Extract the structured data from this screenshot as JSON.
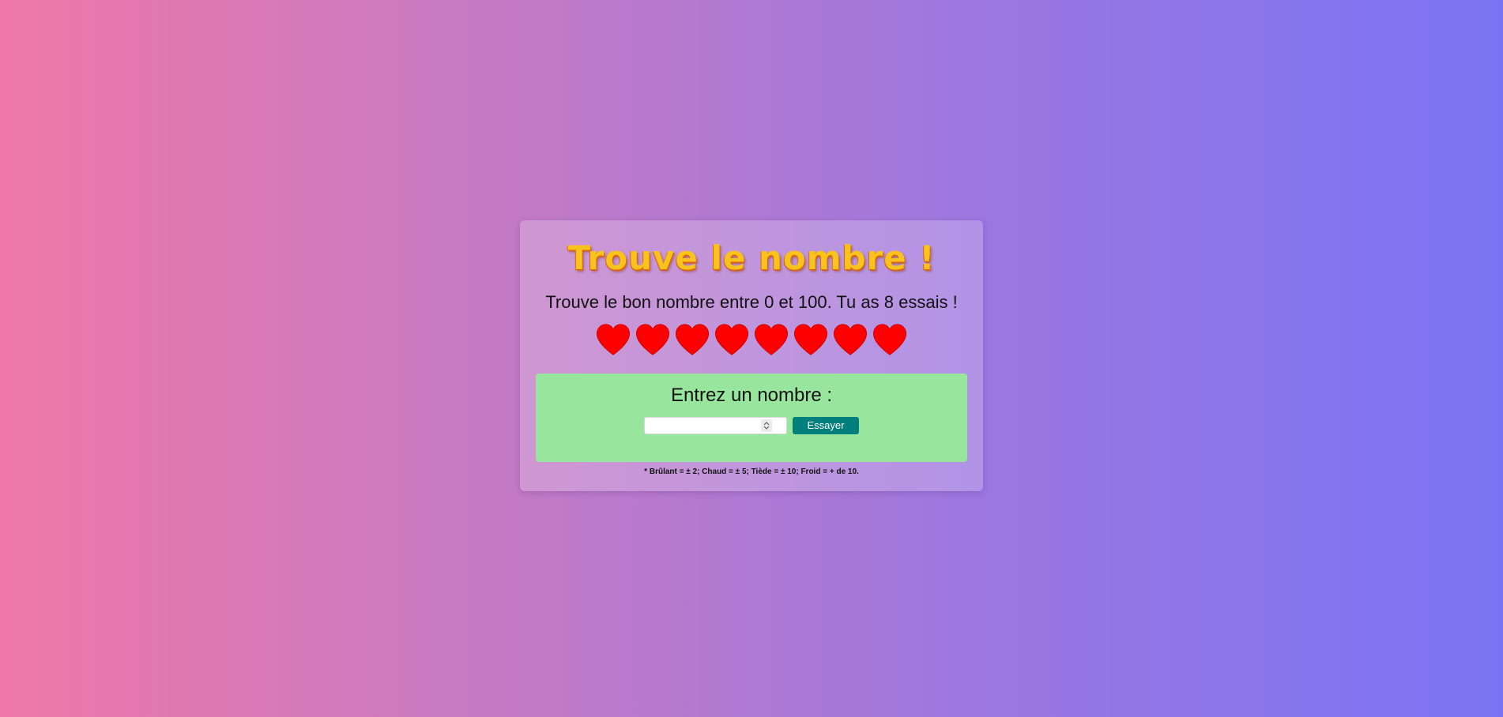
{
  "game": {
    "title": "Trouve le nombre !",
    "subtitle": "Trouve le bon nombre entre 0 et 100. Tu as 8 essais !",
    "lives": {
      "remaining": 8,
      "total": 8,
      "icon": "heart-icon",
      "color": "#ff0000"
    },
    "form": {
      "label": "Entrez un nombre :",
      "input_value": "",
      "button_label": "Essayer"
    },
    "footnote": "* Brûlant = ± 2; Chaud = ± 5; Tiède = ± 10; Froid = + de 10."
  },
  "colors": {
    "title": "#f9c21c",
    "panel": "#98e69e",
    "button": "#007f7c",
    "background_start": "#ef78a8",
    "background_end": "#7a74f4"
  }
}
